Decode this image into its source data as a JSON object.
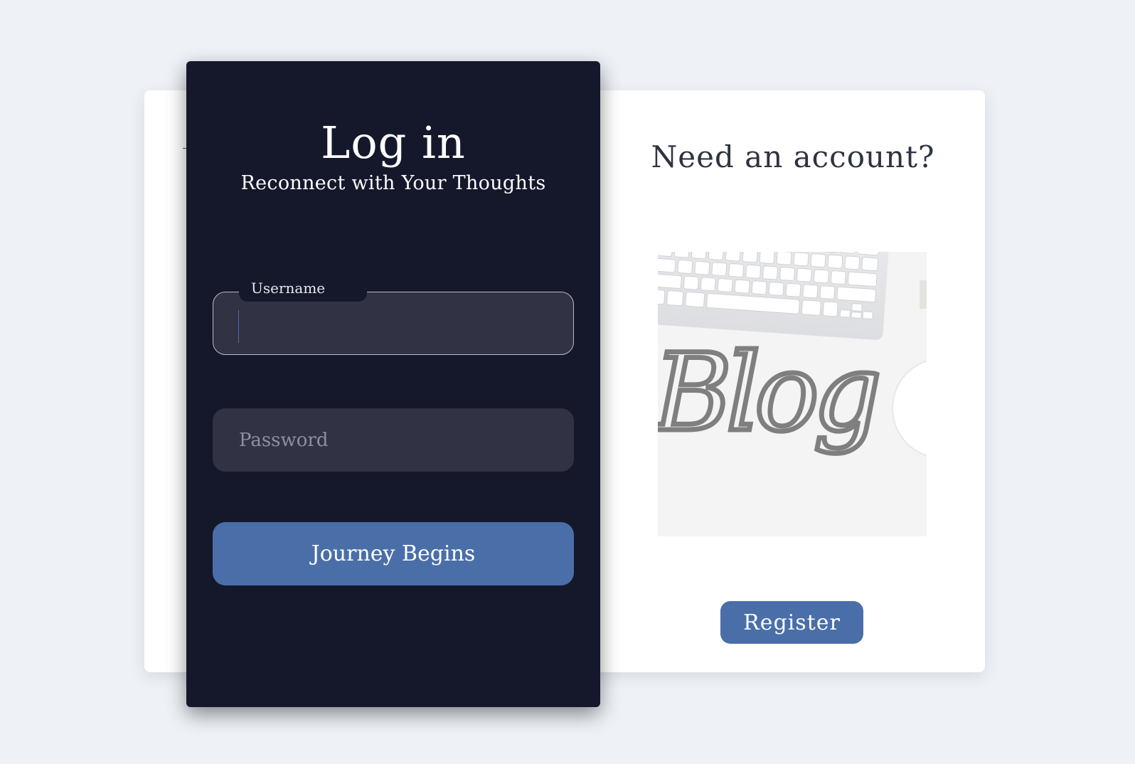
{
  "register": {
    "title": "Need an account?",
    "image_alt": "Blog",
    "button_label": "Register"
  },
  "login": {
    "title": "Log in",
    "subtitle": "Reconnect with Your Thoughts",
    "username": {
      "label": "Username",
      "value": ""
    },
    "password": {
      "placeholder": "Password",
      "value": ""
    },
    "submit_label": "Journey Begins"
  },
  "colors": {
    "background": "#eef2f7",
    "card_dark": "#15182b",
    "input_bg": "#313244",
    "accent": "#4a6fa8",
    "card_light": "#ffffff"
  }
}
